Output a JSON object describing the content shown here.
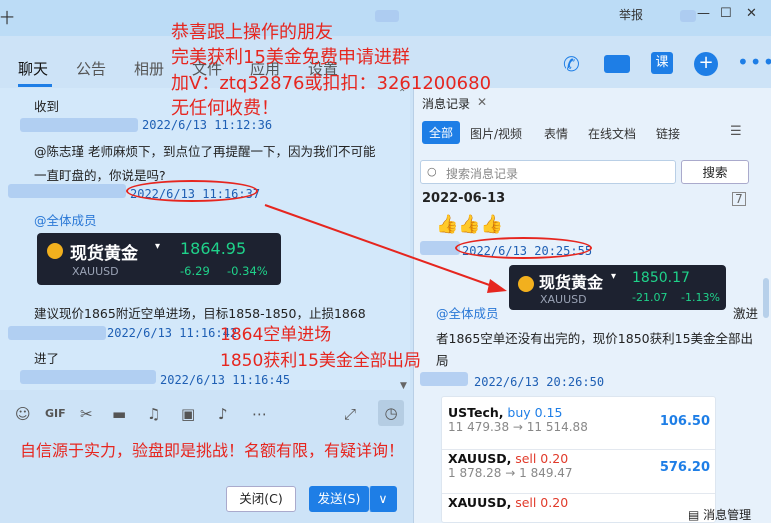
{
  "window": {
    "report": "举报",
    "minimize": "—",
    "maximize": "☐",
    "close": "✕"
  },
  "tabs": [
    "聊天",
    "公告",
    "相册",
    "文件",
    "应用",
    "设置"
  ],
  "chat": {
    "received": "收到",
    "messages": [
      {
        "time": "2022/6/13 11:12:36",
        "text1": "@陈志瑾 老师麻烦下，到点位了再提醒一下，因为我们不可能",
        "text2": "一直盯盘的，你说是吗?"
      },
      {
        "time": "2022/6/13 11:16:37",
        "mention": "@全体成员"
      },
      {
        "text": "建议现价1865附近空单进场，目标1858-1850，止损1868"
      },
      {
        "time": "2022/6/13 11:16:42",
        "text": "进了"
      },
      {
        "time": "2022/6/13 11:16:45"
      }
    ],
    "gold_card": {
      "name": "现货黄金",
      "symbol": "XAUUSD",
      "price": "1864.95",
      "change": "-6.29",
      "change_pct": "-0.34%"
    }
  },
  "input": {
    "close_btn": "关闭(C)",
    "send_btn": "发送(S)",
    "dropdown": "∨"
  },
  "panel": {
    "title": "消息记录",
    "filter_tabs": [
      "全部",
      "图片/视频",
      "表情",
      "在线文档",
      "链接"
    ],
    "search_placeholder": "搜索消息记录",
    "search_btn": "搜索",
    "date": "2022-06-13",
    "emoji": "👍👍👍",
    "time1": "2022/6/13 20:25:55",
    "mention": "@全体成员",
    "text_tail": "激进",
    "text2": "者1865空单还没有出完的，现价1850获利15美金全部出",
    "text3": "局",
    "time2": "2022/6/13 20:26:50",
    "gold_card": {
      "name": "现货黄金",
      "symbol": "XAUUSD",
      "price": "1850.17",
      "change": "-21.07",
      "change_pct": "-1.13%"
    },
    "trades": [
      {
        "symbol": "USTech,",
        "side": "buy 0.15",
        "detail": "11 479.38 → 11 514.88",
        "value": "106.50",
        "side_color": "#1e7ee6"
      },
      {
        "symbol": "XAUUSD,",
        "side": "sell 0.20",
        "detail": "1 878.28 → 1 849.47",
        "value": "576.20",
        "side_color": "#e13a2a"
      },
      {
        "symbol": "XAUUSD,",
        "side": "sell 0.20",
        "detail": "",
        "value": "",
        "side_color": "#e13a2a"
      }
    ],
    "manage": "消息管理"
  },
  "overlay": {
    "line1": "恭喜跟上操作的朋友",
    "line2": "完美获利15美金免费申请进群",
    "line3": "加V：ztq32876或扣扣：3261200680",
    "line4": "无任何收费！",
    "mid1": "1864空单进场",
    "mid2": "1850获利15美金全部出局",
    "bottom": "自信源于实力，验盘即是挑战！名额有限，有疑详询！"
  },
  "colors": {
    "accent": "#1e7ee6",
    "overlay_red": "#e6261f",
    "price_green": "#1fd28a"
  }
}
